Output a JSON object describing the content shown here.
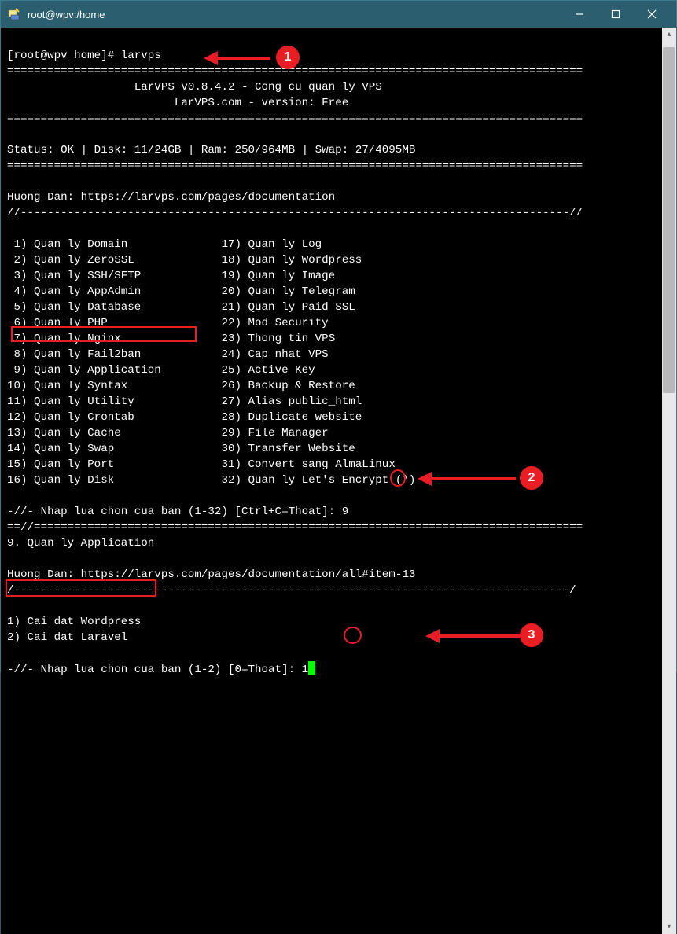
{
  "window": {
    "title": "root@wpv:/home"
  },
  "prompt": {
    "user_host": "[root@wpv home]# ",
    "command": "larvps"
  },
  "header": {
    "line1": "LarVPS v0.8.4.2 - Cong cu quan ly VPS",
    "line2": "LarVPS.com - version: Free"
  },
  "status": "Status: OK | Disk: 11/24GB | Ram: 250/964MB | Swap: 27/4095MB",
  "guide_label": "Huong Dan: ",
  "guide_url": "https://larvps.com/pages/documentation",
  "menu_left": [
    " 1) Quan ly Domain",
    " 2) Quan ly ZeroSSL",
    " 3) Quan ly SSH/SFTP",
    " 4) Quan ly AppAdmin",
    " 5) Quan ly Database",
    " 6) Quan ly PHP",
    " 7) Quan ly Nginx",
    " 8) Quan ly Fail2ban",
    " 9) Quan ly Application",
    "10) Quan ly Syntax",
    "11) Quan ly Utility",
    "12) Quan ly Crontab",
    "13) Quan ly Cache",
    "14) Quan ly Swap",
    "15) Quan ly Port",
    "16) Quan ly Disk"
  ],
  "menu_right": [
    "17) Quan ly Log",
    "18) Quan ly Wordpress",
    "19) Quan ly Image",
    "20) Quan ly Telegram",
    "21) Quan ly Paid SSL",
    "22) Mod Security",
    "23) Thong tin VPS",
    "24) Cap nhat VPS",
    "25) Active Key",
    "26) Backup & Restore",
    "27) Alias public_html",
    "28) Duplicate website",
    "29) File Manager",
    "30) Transfer Website",
    "31) Convert sang AlmaLinux",
    "32) Quan ly Let's Encrypt (*)"
  ],
  "prompt1": "-//- Nhap lua chon cua ban (1-32) [Ctrl+C=Thoat]:",
  "input1": "9",
  "section_title": "9. Quan ly Application",
  "guide2_label": "Huong Dan: ",
  "guide2_url": "https://larvps.com/pages/documentation/all#item-13",
  "submenu": [
    "1) Cai dat Wordpress",
    "2) Cai dat Laravel"
  ],
  "prompt2": "-//- Nhap lua chon cua ban (1-2) [0=Thoat]:",
  "input2": "1",
  "badges": {
    "b1": "1",
    "b2": "2",
    "b3": "3"
  },
  "divider_eq": "======================================================================================",
  "divider_eq2": "==//==================================================================================",
  "divider_dash": "//----------------------------------------------------------------------------------//",
  "divider_dash2": "/-----------------------------------------------------------------------------------/"
}
